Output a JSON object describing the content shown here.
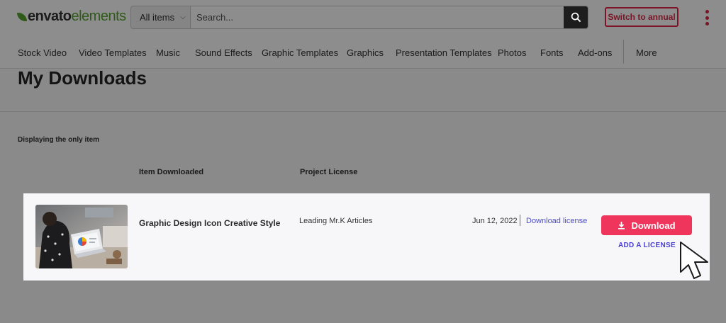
{
  "header": {
    "logo_part1": "envato",
    "logo_part2": "elements",
    "filter_label": "All items",
    "search_placeholder": "Search...",
    "switch_label": "Switch to annual"
  },
  "nav": {
    "items": [
      "Stock Video",
      "Video Templates",
      "Music",
      "Sound Effects",
      "Graphic Templates",
      "Graphics",
      "Presentation Templates",
      "Photos",
      "Fonts",
      "Add-ons"
    ],
    "more": "More"
  },
  "page": {
    "title": "My Downloads",
    "display_text": "Displaying the only item",
    "columns": [
      "Item Downloaded",
      "Project License"
    ]
  },
  "row": {
    "item_name": "Graphic Design Icon Creative Style",
    "project": "Leading Mr.K Articles",
    "date": "Jun 12, 2022",
    "download_license": "Download license",
    "download_button": "Download",
    "add_license": "ADD A LICENSE"
  },
  "colors": {
    "accent": "#f0355c",
    "link": "#4a4ad0",
    "brand_green": "#2f5a1a"
  }
}
